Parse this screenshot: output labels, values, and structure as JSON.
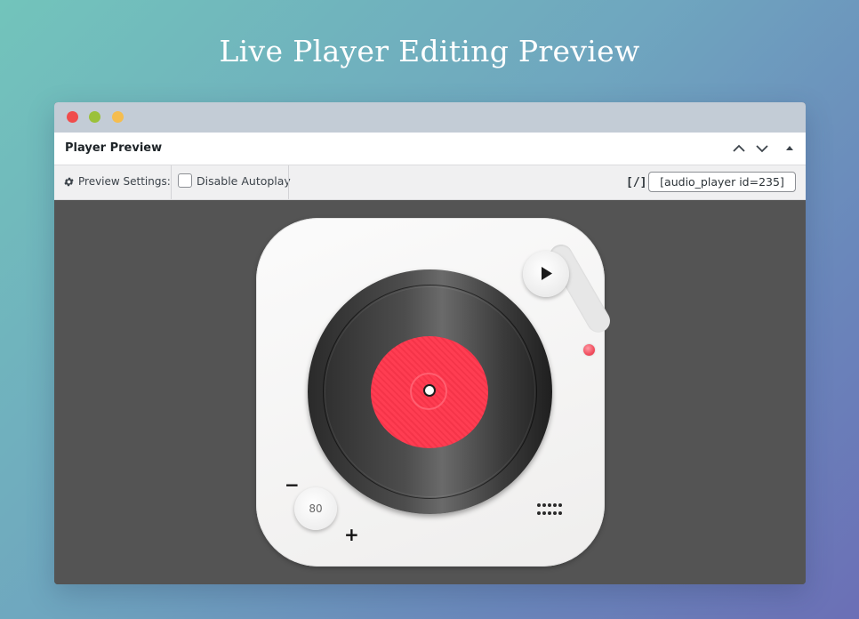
{
  "page": {
    "title": "Live Player Editing Preview"
  },
  "panel": {
    "title": "Player Preview"
  },
  "toolbar": {
    "preview_settings_label": "Preview Settings:",
    "autoplay_label": "Disable Autoplay",
    "autoplay_checked": false,
    "code_icon_text": "[/]",
    "shortcode_value": "[audio_player id=235]"
  },
  "player": {
    "volume": "80",
    "volume_minus": "−",
    "volume_plus": "+",
    "label_color": "#ff3d52"
  },
  "colors": {
    "stage_bg": "#545454",
    "close": "#f04c4c",
    "minimize": "#9bc13a",
    "maximize": "#f5bd4f"
  }
}
